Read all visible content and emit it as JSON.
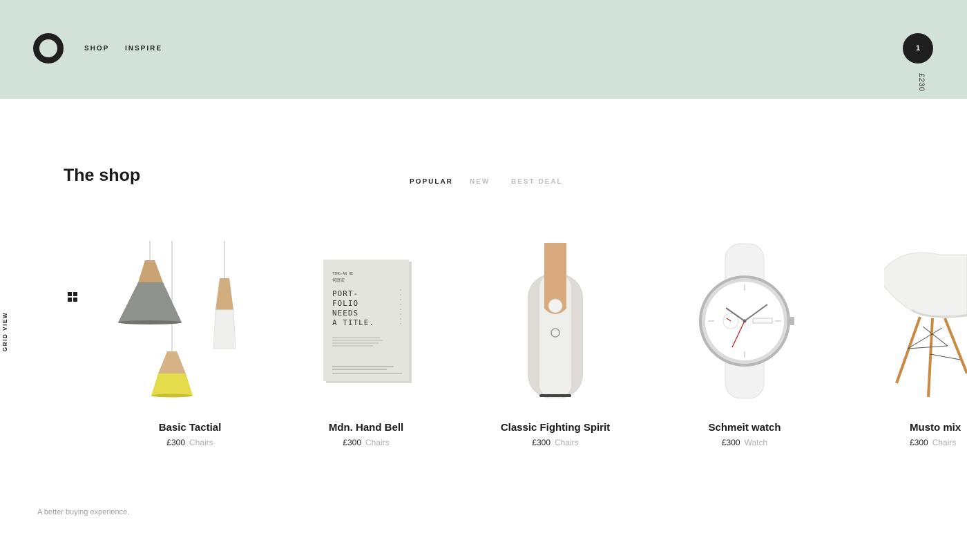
{
  "header": {
    "nav": [
      "SHOP",
      "INSPIRE"
    ],
    "cart_count": "1",
    "cart_total": "£230",
    "logo_icon": "ring-logo-icon",
    "background": "#d3e2d8"
  },
  "shop": {
    "title": "The shop",
    "tabs": [
      {
        "label": "POPULAR",
        "active": true
      },
      {
        "label": "NEW",
        "active": false
      },
      {
        "label": "BEST DEAL",
        "active": false
      }
    ],
    "view_toggle": {
      "label": "GRID VIEW",
      "icon": "grid-icon"
    }
  },
  "products": [
    {
      "name": "Basic Tactial",
      "price": "£300",
      "category": "Chairs",
      "image": "pendant-lamps"
    },
    {
      "name": "Mdn. Hand Bell",
      "price": "£300",
      "category": "Chairs",
      "image": "portfolio-book",
      "image_text": [
        "TING-AN HE",
        "何庭安",
        "PORT-",
        "FOLIO",
        "NEEDS",
        "A TITLE."
      ]
    },
    {
      "name": "Classic Fighting Spirit",
      "price": "£300",
      "category": "Chairs",
      "image": "portable-speaker"
    },
    {
      "name": "Schmeit watch",
      "price": "£300",
      "category": "Watch",
      "image": "wrist-watch"
    },
    {
      "name": "Musto mix",
      "price": "£300",
      "category": "Chairs",
      "image": "shell-chair"
    }
  ],
  "footer": {
    "tagline": "A better buying experience."
  }
}
